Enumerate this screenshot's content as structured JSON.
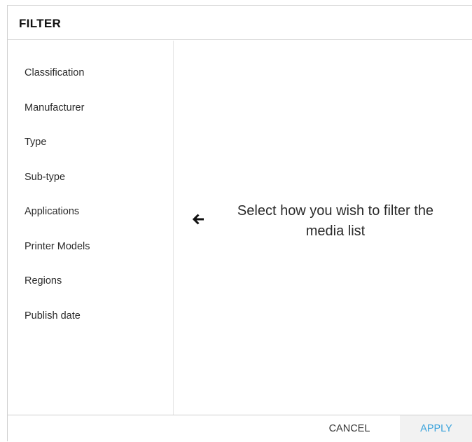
{
  "dialog": {
    "title": "FILTER"
  },
  "sidebar": {
    "items": [
      {
        "label": "Classification"
      },
      {
        "label": "Manufacturer"
      },
      {
        "label": "Type"
      },
      {
        "label": "Sub-type"
      },
      {
        "label": "Applications"
      },
      {
        "label": "Printer Models"
      },
      {
        "label": "Regions"
      },
      {
        "label": "Publish date"
      }
    ]
  },
  "content": {
    "hint_text": "Select how you wish to filter the media list",
    "hint_icon": "arrow-left-icon"
  },
  "footer": {
    "cancel_label": "CANCEL",
    "apply_label": "APPLY"
  },
  "colors": {
    "apply_text": "#3aa3dc",
    "apply_background": "#f2f2f2",
    "divider": "#cfcfcf"
  }
}
